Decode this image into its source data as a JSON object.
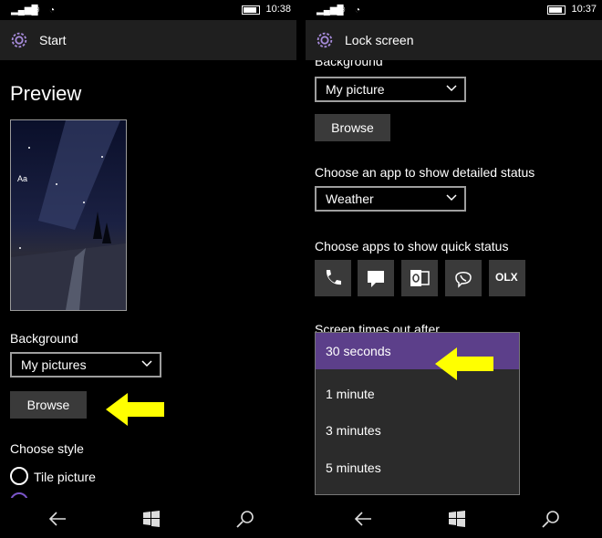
{
  "left": {
    "status": {
      "signal": "📶",
      "time": "10:38"
    },
    "header_title": "Start",
    "preview_title": "Preview",
    "preview_sample_text": "Aa",
    "background_label": "Background",
    "background_value": "My pictures",
    "browse_label": "Browse",
    "choose_style_label": "Choose style",
    "style_option_1": "Tile picture"
  },
  "right": {
    "status": {
      "signal": "📶",
      "time": "10:37"
    },
    "header_title": "Lock screen",
    "background_label": "Background",
    "background_value": "My picture",
    "browse_label": "Browse",
    "detailed_status_label": "Choose an app to show detailed status",
    "detailed_status_value": "Weather",
    "quick_status_label": "Choose apps to show quick status",
    "quick_icons": [
      "phone-icon",
      "message-icon",
      "outlook-icon",
      "viber-icon",
      "olx-icon"
    ],
    "olx_text": "OLX",
    "timeout_label": "Screen times out after",
    "timeout_options": [
      "30 seconds",
      "1 minute",
      "3 minutes",
      "5 minutes"
    ],
    "timeout_selected_index": 0
  },
  "colors": {
    "accent": "#5c3f8a",
    "highlight_arrow": "#ffff00"
  }
}
